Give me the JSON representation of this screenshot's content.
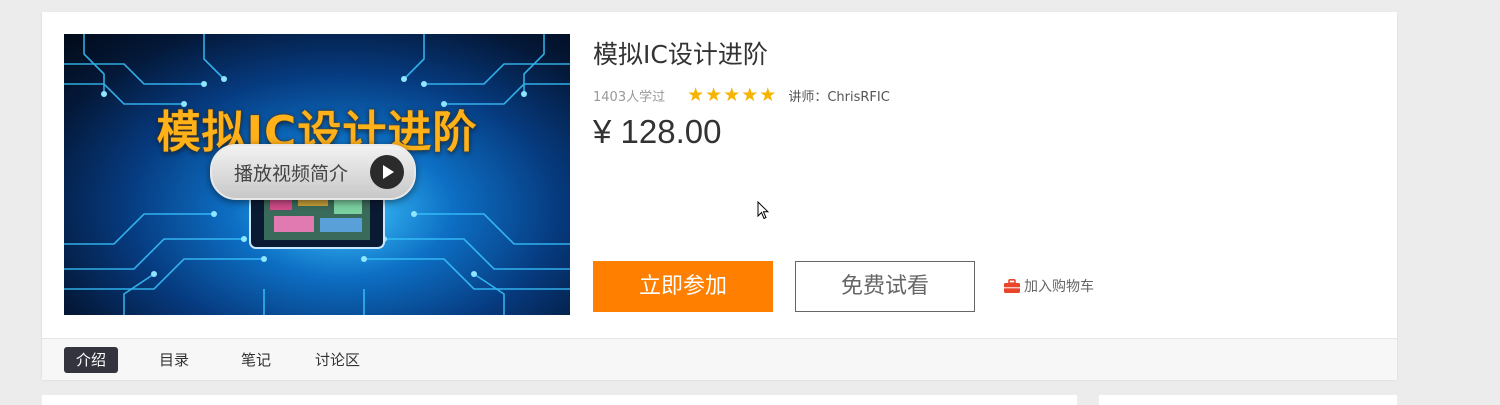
{
  "course": {
    "thumbnail": {
      "title_text": "模拟IC设计进阶",
      "play_label": "播放视频简介"
    },
    "title": "模拟IC设计进阶",
    "learners": "1403人学过",
    "rating": {
      "stars": 5,
      "max": 5
    },
    "teacher": "讲师：ChrisRFIC",
    "price": "¥ 128.00"
  },
  "actions": {
    "join_label": "立即参加",
    "trial_label": "免费试看",
    "cart_label": "加入购物车"
  },
  "tabs": [
    {
      "label": "介绍",
      "active": true
    },
    {
      "label": "目录",
      "active": false
    },
    {
      "label": "笔记",
      "active": false
    },
    {
      "label": "讨论区",
      "active": false
    }
  ],
  "colors": {
    "accent_orange": "#ff7f00",
    "star": "#f5b400",
    "active_tab_bg": "#34343f",
    "cart_icon": "#e8452c"
  }
}
